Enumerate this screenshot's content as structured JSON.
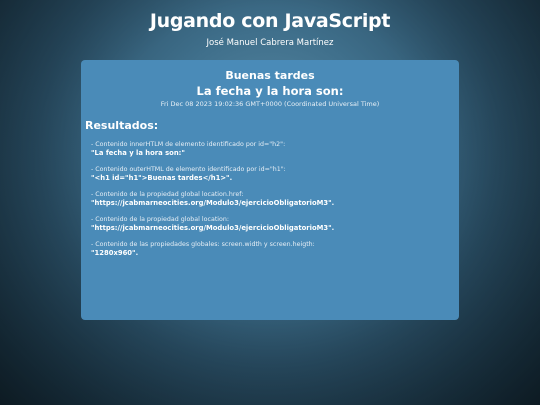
{
  "header": {
    "title": "Jugando con JavaScript",
    "author": "José Manuel Cabrera Martínez"
  },
  "panel": {
    "greeting": "Buenas tardes",
    "datetime_heading": "La fecha y la hora son:",
    "datetime_value": "Fri Dec 08 2023 19:02:36 GMT+0000 (Coordinated Universal Time)",
    "results_heading": "Resultados:",
    "results": [
      {
        "description": "- Contenido innerHTLM de elemento identificado por id=\"h2\":",
        "value": "\"La fecha y la hora son:\""
      },
      {
        "description": "- Contenido outerHTML de elemento identificado por id=\"h1\":",
        "value": "\"<h1 id=\"h1\">Buenas tardes</h1>\"."
      },
      {
        "description": "- Contenido de la propiedad global location.href:",
        "value": "\"https://jcabmarneocities.org/Modulo3/ejercicioObligatorioM3\"."
      },
      {
        "description": "- Contenido de la propiedad global location:",
        "value": "\"https://jcabmarneocities.org/Modulo3/ejercicioObligatorioM3\"."
      },
      {
        "description": "- Contenido de las propiedades globales: screen.width y screen.heigth:",
        "value": "\"1280x960\"."
      }
    ]
  }
}
